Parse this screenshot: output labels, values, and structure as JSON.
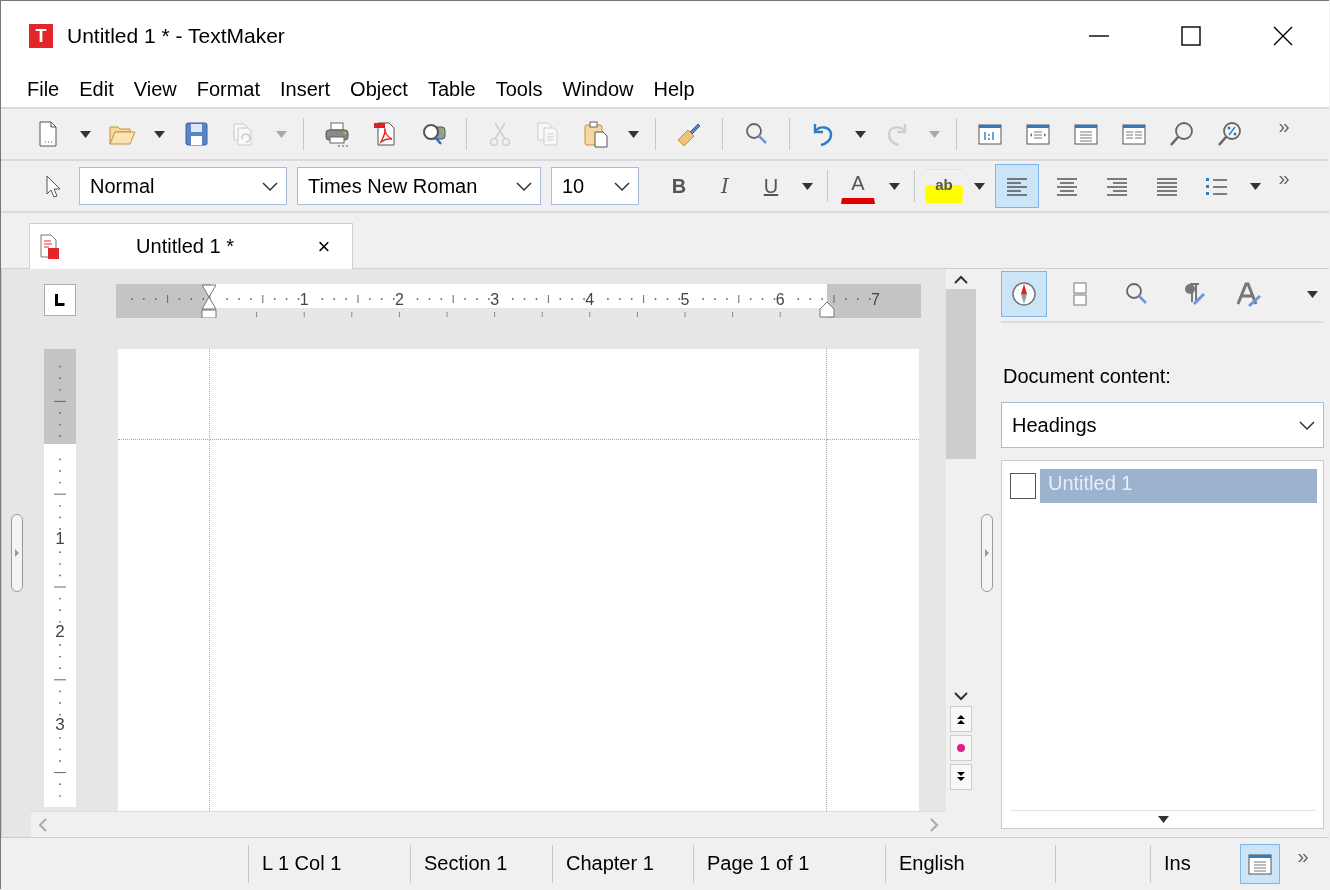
{
  "window": {
    "title": "Untitled 1 * - TextMaker",
    "icon_letter": "T"
  },
  "menu": [
    {
      "label": "File"
    },
    {
      "label": "Edit"
    },
    {
      "label": "View"
    },
    {
      "label": "Format"
    },
    {
      "label": "Insert"
    },
    {
      "label": "Object"
    },
    {
      "label": "Table"
    },
    {
      "label": "Tools"
    },
    {
      "label": "Window"
    },
    {
      "label": "Help"
    }
  ],
  "toolbar": [
    {
      "kind": "new",
      "disabled": false
    },
    {
      "kind": "dropdown",
      "disabled": false
    },
    {
      "kind": "open",
      "disabled": false
    },
    {
      "kind": "dropdown",
      "disabled": false
    },
    {
      "kind": "save",
      "disabled": false
    },
    {
      "kind": "revert",
      "disabled": true
    },
    {
      "kind": "dropdown",
      "disabled": true
    },
    {
      "kind": "separator"
    },
    {
      "kind": "print",
      "disabled": false
    },
    {
      "kind": "pdf",
      "disabled": false
    },
    {
      "kind": "preview",
      "disabled": false
    },
    {
      "kind": "separator"
    },
    {
      "kind": "cut",
      "disabled": true
    },
    {
      "kind": "copy",
      "disabled": true
    },
    {
      "kind": "paste",
      "disabled": false
    },
    {
      "kind": "dropdown",
      "disabled": false
    },
    {
      "kind": "separator"
    },
    {
      "kind": "brush",
      "disabled": false
    },
    {
      "kind": "separator"
    },
    {
      "kind": "search",
      "disabled": false
    },
    {
      "kind": "separator"
    },
    {
      "kind": "undo",
      "disabled": false
    },
    {
      "kind": "dropdown",
      "disabled": false
    },
    {
      "kind": "redo",
      "disabled": true
    },
    {
      "kind": "dropdown",
      "disabled": true
    },
    {
      "kind": "separator"
    },
    {
      "kind": "view_actual",
      "disabled": false
    },
    {
      "kind": "view_width",
      "disabled": false
    },
    {
      "kind": "view_page",
      "disabled": false
    },
    {
      "kind": "view_two",
      "disabled": false
    },
    {
      "kind": "zoom",
      "disabled": false
    },
    {
      "kind": "zoom_percent",
      "disabled": false
    },
    {
      "kind": "more",
      "label": "»"
    }
  ],
  "format_bar": {
    "style": "Normal",
    "font": "Times New Roman",
    "size": "10",
    "buttons": [
      {
        "kind": "bold",
        "label": "B"
      },
      {
        "kind": "italic",
        "label": "I"
      },
      {
        "kind": "underline",
        "label": "U"
      },
      {
        "kind": "dropdown"
      },
      {
        "kind": "separator"
      },
      {
        "kind": "font_color",
        "label": "A"
      },
      {
        "kind": "dropdown"
      },
      {
        "kind": "separator"
      },
      {
        "kind": "highlight",
        "label": "ab"
      },
      {
        "kind": "dropdown"
      },
      {
        "kind": "align_left",
        "selected": true
      },
      {
        "kind": "align_center",
        "selected": false
      },
      {
        "kind": "align_right",
        "selected": false
      },
      {
        "kind": "justify",
        "selected": false
      },
      {
        "kind": "bullets"
      },
      {
        "kind": "dropdown"
      },
      {
        "kind": "more",
        "label": "»"
      }
    ]
  },
  "tabs": [
    {
      "label": "Untitled 1 *",
      "selected": true,
      "close": "×"
    }
  ],
  "ruler": {
    "labels": [
      "1",
      "2",
      "3",
      "4",
      "5",
      "6",
      "7"
    ]
  },
  "vertical_ruler": {
    "labels": [
      "1",
      "2",
      "3"
    ]
  },
  "sidebar": {
    "tools": [
      {
        "kind": "navigator",
        "selected": true
      },
      {
        "kind": "frames",
        "selected": false
      },
      {
        "kind": "search",
        "selected": false
      },
      {
        "kind": "paragraph_style",
        "selected": false
      },
      {
        "kind": "character_style",
        "selected": false
      }
    ],
    "label": "Document content:",
    "dropdown": "Headings",
    "items": [
      {
        "label": "Untitled 1",
        "selected": true,
        "checked": false
      }
    ]
  },
  "status_bar": {
    "cells": [
      "L 1 Col 1",
      "Section 1",
      "Chapter 1",
      "Page 1 of 1",
      "English"
    ],
    "mode": "Ins",
    "more": "»"
  }
}
